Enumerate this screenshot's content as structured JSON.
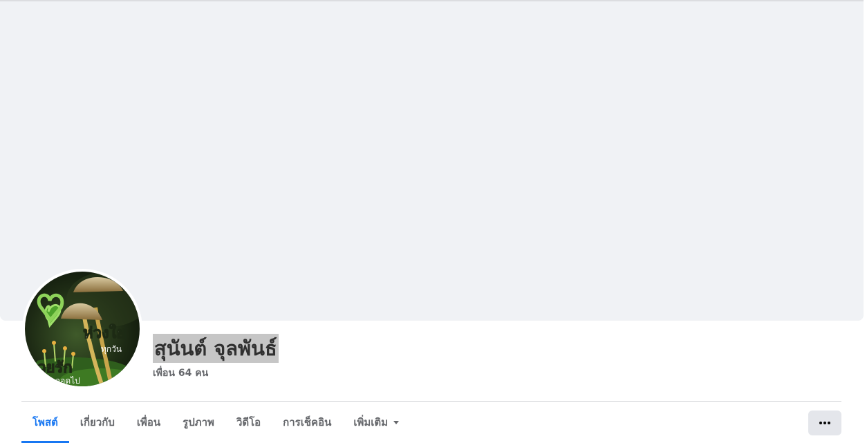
{
  "profile": {
    "name": "สุนันต์ จุลพันธ์",
    "friends_count": "เพื่อน 64 คน"
  },
  "tabs": [
    {
      "label": "โพสต์",
      "active": true
    },
    {
      "label": "เกี่ยวกับ",
      "active": false
    },
    {
      "label": "เพื่อน",
      "active": false
    },
    {
      "label": "รูปภาพ",
      "active": false
    },
    {
      "label": "วิดีโอ",
      "active": false
    },
    {
      "label": "การเช็คอิน",
      "active": false
    },
    {
      "label": "เพิ่มเติม",
      "active": false
    }
  ],
  "avatar_text": [
    "ห่วงใย",
    "ทุกวัน",
    "ด้วยรัก",
    "ตลอดไป"
  ],
  "icons": {
    "more_tab": "chevron-down-icon",
    "more_button": "more-horizontal-icon"
  },
  "colors": {
    "accent": "#1877f2",
    "cover": "#f0f2f5",
    "tab_text": "#65676b",
    "name_highlight": "#c6c6c6"
  }
}
